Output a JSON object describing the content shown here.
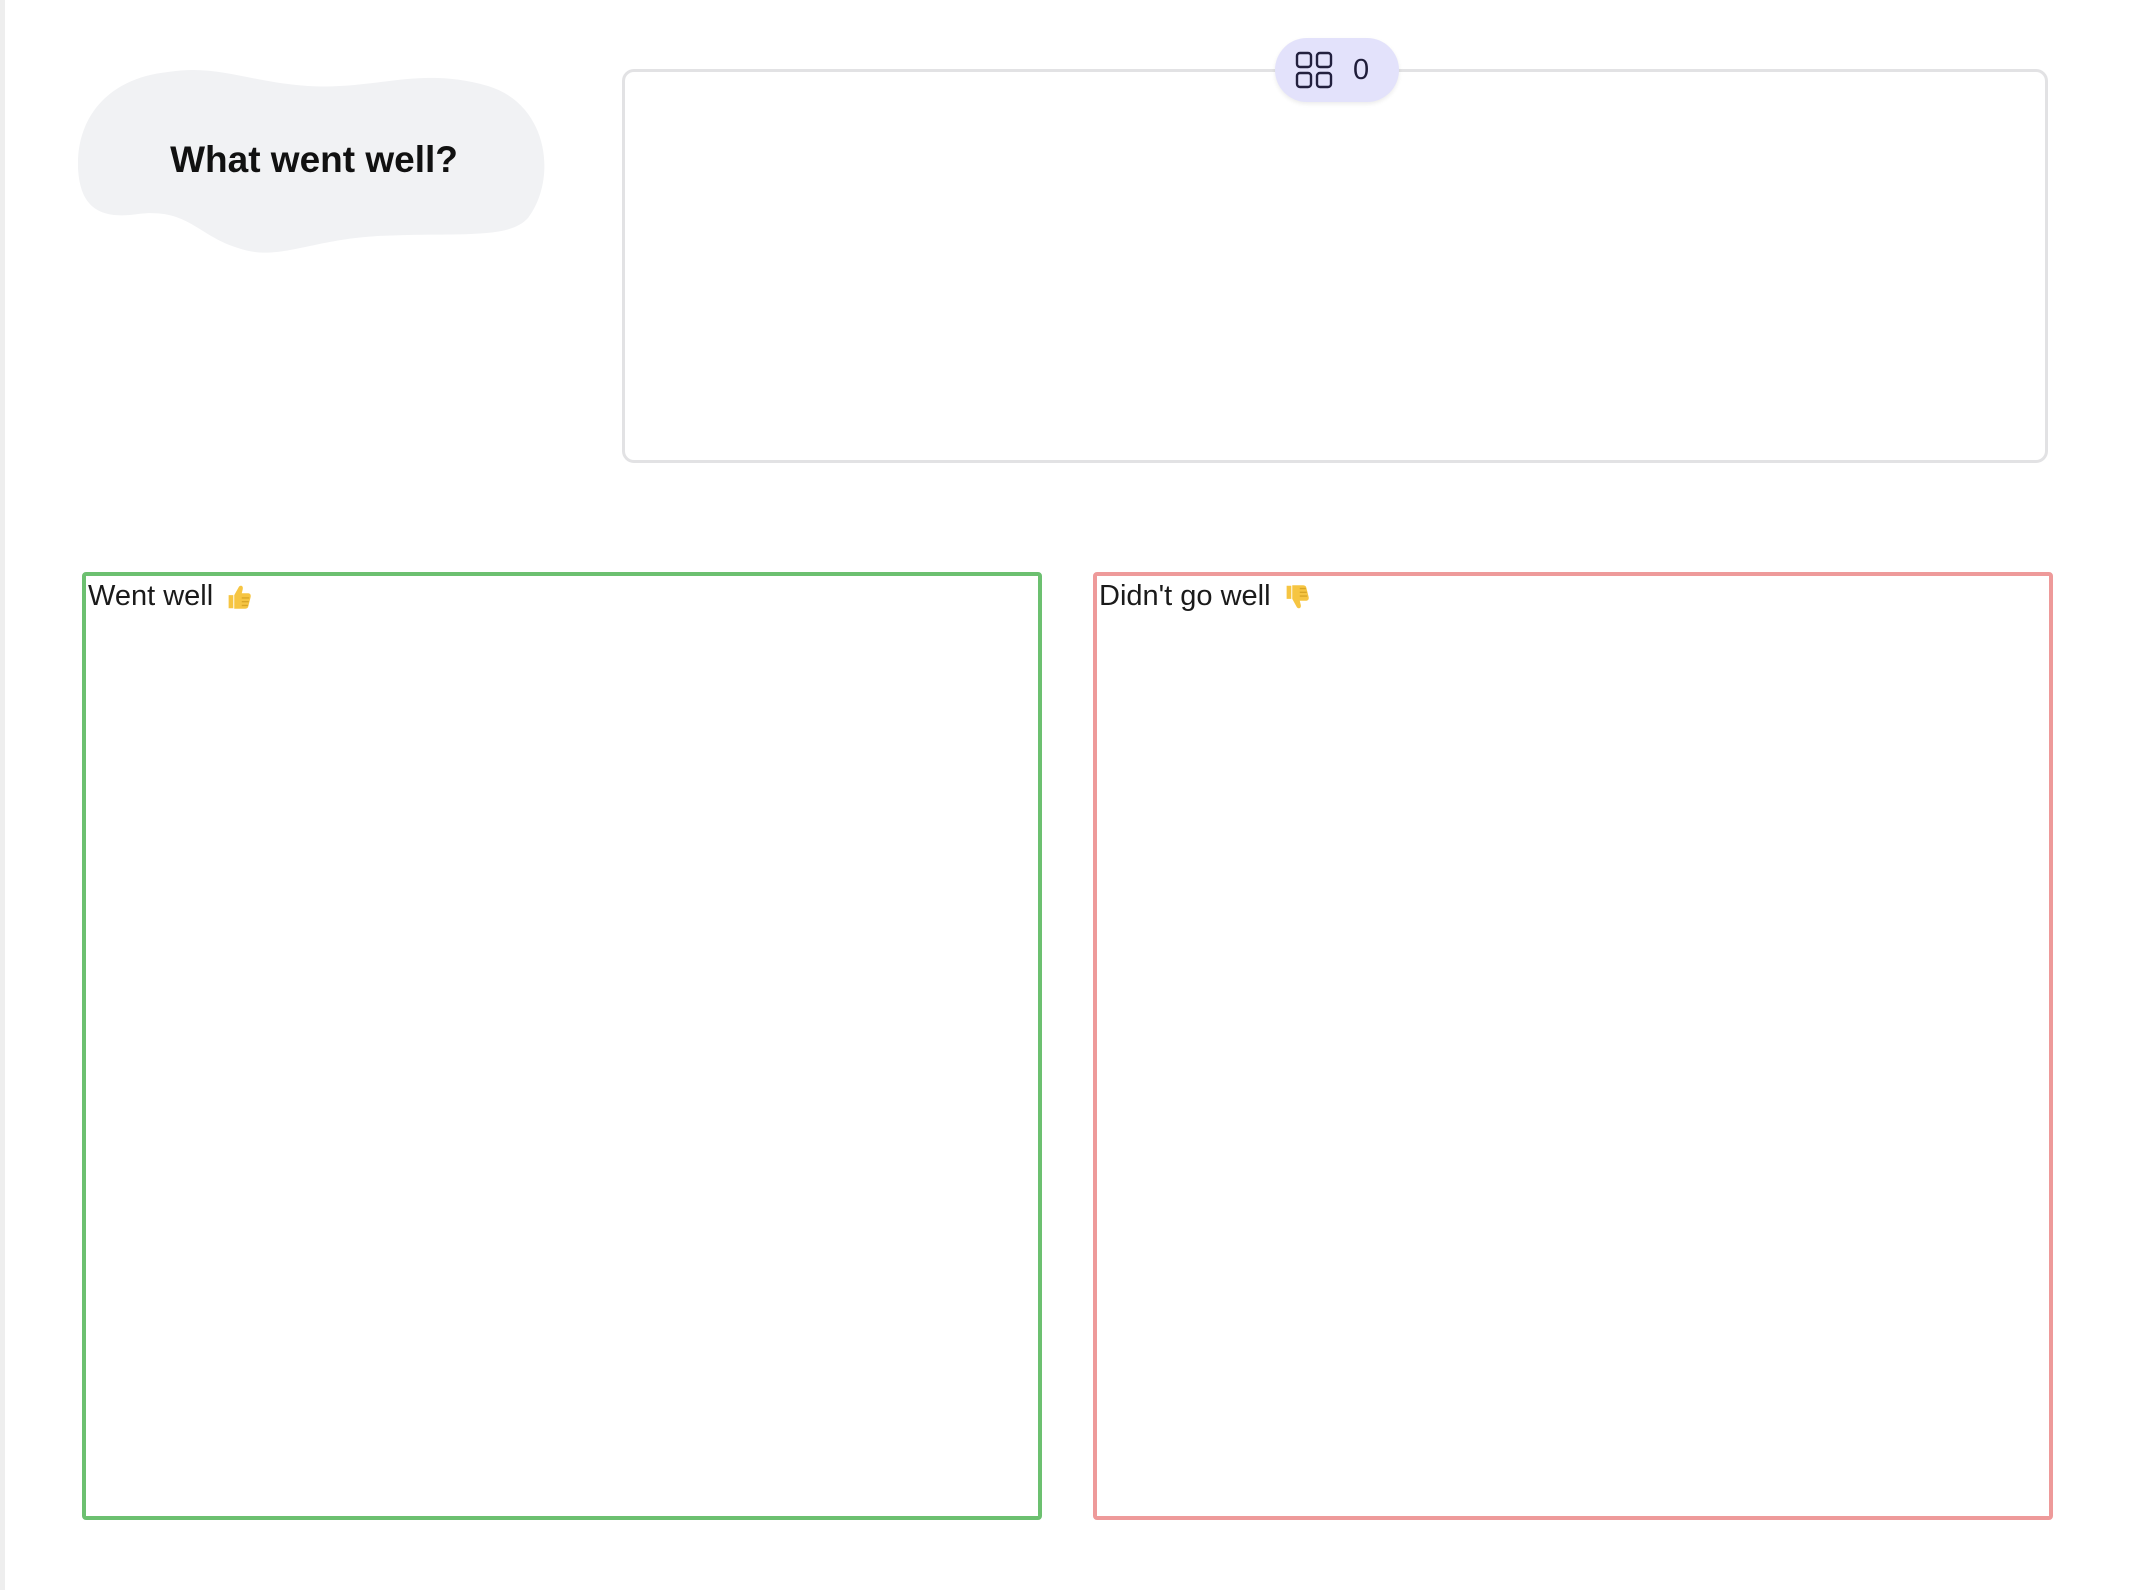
{
  "board": {
    "sticky_title": "What went well?",
    "frame_counter": {
      "icon": "grid-icon",
      "value": "0"
    },
    "columns": [
      {
        "label": "Went well",
        "icon": "thumbs-up-icon",
        "border_color": "#6cc070"
      },
      {
        "label": "Didn't go well",
        "icon": "thumbs-down-icon",
        "border_color": "#ee9a9a"
      }
    ]
  },
  "colors": {
    "blob_fill": "#f1f2f4",
    "frame_border": "#e2e2e4",
    "pill_fill": "#e3e2fb",
    "emoji_yellow": "#f6c542"
  }
}
